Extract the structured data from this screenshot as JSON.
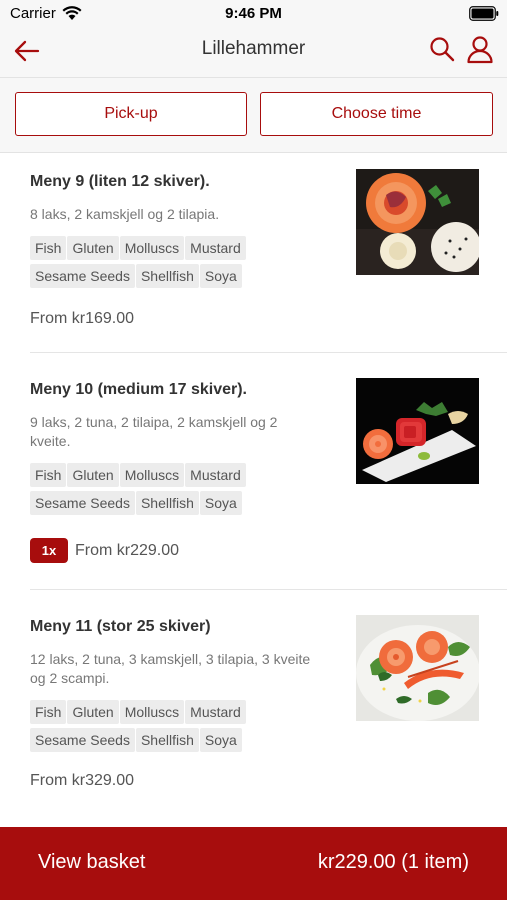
{
  "status_bar": {
    "carrier": "Carrier",
    "time": "9:46 PM"
  },
  "nav": {
    "title": "Lillehammer"
  },
  "segments": {
    "pickup": "Pick-up",
    "choose_time": "Choose time"
  },
  "items": [
    {
      "title": "Meny 9 (liten 12 skiver).",
      "description": "8 laks, 2 kamskjell og 2 tilapia.",
      "tags": [
        "Fish",
        "Gluten",
        "Molluscs",
        "Mustard",
        "Sesame Seeds",
        "Shellfish",
        "Soya"
      ],
      "price": "From kr169.00",
      "quantity": ""
    },
    {
      "title": "Meny 10 (medium 17 skiver).",
      "description": "9 laks, 2 tuna, 2 tilaipa, 2 kamskjell og 2 kveite.",
      "tags": [
        "Fish",
        "Gluten",
        "Molluscs",
        "Mustard",
        "Sesame Seeds",
        "Shellfish",
        "Soya"
      ],
      "price": "From kr229.00",
      "quantity": "1x"
    },
    {
      "title": "Meny 11 (stor 25 skiver)",
      "description": "12 laks, 2 tuna, 3 kamskjell, 3 tilapia, 3 kveite og 2 scampi.",
      "tags": [
        "Fish",
        "Gluten",
        "Molluscs",
        "Mustard",
        "Sesame Seeds",
        "Shellfish",
        "Soya"
      ],
      "price": "From kr329.00",
      "quantity": ""
    }
  ],
  "basket": {
    "label": "View basket",
    "total": "kr229.00 (1 item)"
  },
  "colors": {
    "accent": "#a70d0d",
    "tag_bg": "#ececec",
    "bar_bg": "#f7f7f7"
  }
}
